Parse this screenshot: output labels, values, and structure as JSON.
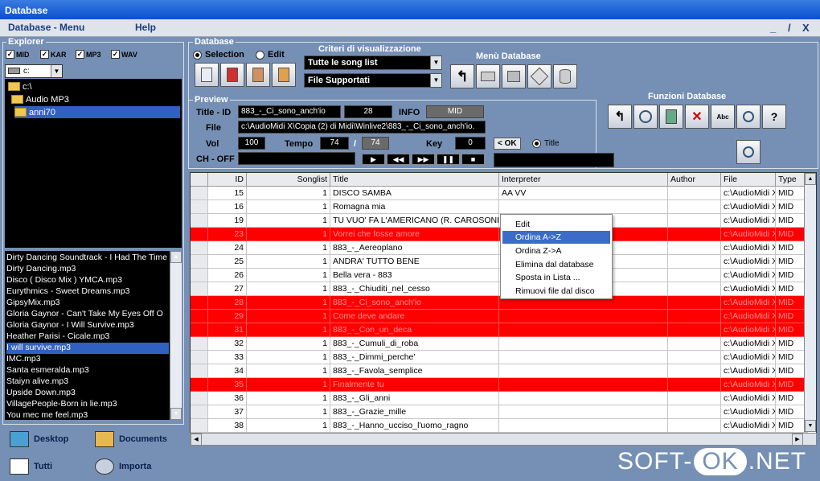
{
  "window": {
    "title": "Database"
  },
  "menu": {
    "items": [
      "Database - Menu",
      "Help"
    ],
    "controls": [
      "_",
      "/",
      "X"
    ]
  },
  "explorer": {
    "label": "Explorer",
    "filters": [
      {
        "label": "MID",
        "checked": true
      },
      {
        "label": "KAR",
        "checked": true
      },
      {
        "label": "MP3",
        "checked": true
      },
      {
        "label": "WAV",
        "checked": true
      }
    ],
    "drive": "c:",
    "tree": [
      "c:\\",
      "Audio MP3",
      "anni70"
    ],
    "files": [
      "Dirty Dancing Soundtrack - I Had The Time",
      "Dirty Dancing.mp3",
      "Disco ( Disco Mix ) YMCA.mp3",
      "Eurythmics - Sweet Dreams.mp3",
      "GipsyMix.mp3",
      "Gloria Gaynor - Can't Take My Eyes Off O",
      "Gloria Gaynor - I Will Survive.mp3",
      "Heather Parisi - Cicale.mp3",
      "I will survive.mp3",
      "IMC.mp3",
      "Santa esmeralda.mp3",
      "Staiyn alive.mp3",
      "Upside Down.mp3",
      "VillagePeople-Born in lie.mp3",
      "You mec me feel.mp3"
    ],
    "selected_file": 8,
    "nav": [
      "Desktop",
      "Documents",
      "Tutti",
      "Importa"
    ]
  },
  "database": {
    "label": "Database",
    "mode_selection": "Selection",
    "mode_edit": "Edit",
    "criteria_label": "Criteri di visualizzazione",
    "criteria_1": "Tutte le song list",
    "criteria_2": "File Supportati",
    "menu_label": "Menù Database",
    "functions_label": "Funzioni Database"
  },
  "preview": {
    "label": "Preview",
    "title_id_label": "Title - ID",
    "title_value": "883_-_Ci_sono_anch'io",
    "id_value": "28",
    "info_label": "INFO",
    "info_value": "MID",
    "file_label": "File",
    "file_value": "c:\\AudioMidi X\\Copia (2) di Midi\\Winlive2\\883_-_Ci_sono_anch'io.",
    "vol_label": "Vol",
    "vol_value": "100",
    "tempo_label": "Tempo",
    "tempo_value": "74",
    "tempo_sep": "/",
    "tempo_max": "74",
    "key_label": "Key",
    "key_value": "0",
    "ch_off_label": "CH - OFF",
    "ok_label": "< OK",
    "title_radio": "Title",
    "player": [
      "▶",
      "◀◀",
      "▶▶",
      "❚❚",
      "■"
    ]
  },
  "grid": {
    "columns": [
      "ID",
      "Songlist",
      "Title",
      "Interpreter",
      "Author",
      "File",
      "Type"
    ],
    "rows": [
      {
        "id": "15",
        "songlist": "1",
        "title": "DISCO SAMBA",
        "interpreter": "AA VV",
        "author": "",
        "file": "c:\\AudioMidi X",
        "type": "MID",
        "red": false
      },
      {
        "id": "16",
        "songlist": "1",
        "title": "Romagna mia",
        "interpreter": "",
        "author": "",
        "file": "c:\\AudioMidi X",
        "type": "MID",
        "red": false
      },
      {
        "id": "19",
        "songlist": "1",
        "title": "TU VUO' FA L'AMERICANO (R. CAROSONE)",
        "interpreter": "",
        "author": "",
        "file": "c:\\AudioMidi X",
        "type": "MID",
        "red": false
      },
      {
        "id": "23",
        "songlist": "1",
        "title": "Vorrei che fosse amore",
        "interpreter": "",
        "author": "",
        "file": "c:\\AudioMidi X",
        "type": "MID",
        "red": true
      },
      {
        "id": "24",
        "songlist": "1",
        "title": "883_-_Aereoplano",
        "interpreter": "",
        "author": "",
        "file": "c:\\AudioMidi X",
        "type": "MID",
        "red": false
      },
      {
        "id": "25",
        "songlist": "1",
        "title": "ANDRA' TUTTO BENE",
        "interpreter": "",
        "author": "",
        "file": "c:\\AudioMidi X",
        "type": "MID",
        "red": false
      },
      {
        "id": "26",
        "songlist": "1",
        "title": "Bella vera - 883",
        "interpreter": "",
        "author": "",
        "file": "c:\\AudioMidi X",
        "type": "MID",
        "red": false
      },
      {
        "id": "27",
        "songlist": "1",
        "title": "883_-_Chiuditi_nel_cesso",
        "interpreter": "",
        "author": "",
        "file": "c:\\AudioMidi X",
        "type": "MID",
        "red": false
      },
      {
        "id": "28",
        "songlist": "1",
        "title": "883_-_Ci_sono_anch'io",
        "interpreter": "",
        "author": "",
        "file": "c:\\AudioMidi X",
        "type": "MID",
        "red": true
      },
      {
        "id": "29",
        "songlist": "1",
        "title": "Come deve andare",
        "interpreter": "",
        "author": "",
        "file": "c:\\AudioMidi X",
        "type": "MID",
        "red": true
      },
      {
        "id": "31",
        "songlist": "1",
        "title": "883_-_Con_un_deca",
        "interpreter": "",
        "author": "",
        "file": "c:\\AudioMidi X",
        "type": "MID",
        "red": true
      },
      {
        "id": "32",
        "songlist": "1",
        "title": "883_-_Cumuli_di_roba",
        "interpreter": "",
        "author": "",
        "file": "c:\\AudioMidi X",
        "type": "MID",
        "red": false
      },
      {
        "id": "33",
        "songlist": "1",
        "title": "883_-_Dimmi_perche'",
        "interpreter": "",
        "author": "",
        "file": "c:\\AudioMidi X",
        "type": "MID",
        "red": false
      },
      {
        "id": "34",
        "songlist": "1",
        "title": "883_-_Favola_semplice",
        "interpreter": "",
        "author": "",
        "file": "c:\\AudioMidi X",
        "type": "MID",
        "red": false
      },
      {
        "id": "35",
        "songlist": "1",
        "title": "Finalmente tu",
        "interpreter": "",
        "author": "",
        "file": "c:\\AudioMidi X",
        "type": "MID",
        "red": true
      },
      {
        "id": "36",
        "songlist": "1",
        "title": "883_-_Gli_anni",
        "interpreter": "",
        "author": "",
        "file": "c:\\AudioMidi X",
        "type": "MID",
        "red": false
      },
      {
        "id": "37",
        "songlist": "1",
        "title": "883_-_Grazie_mille",
        "interpreter": "",
        "author": "",
        "file": "c:\\AudioMidi X",
        "type": "MID",
        "red": false
      },
      {
        "id": "38",
        "songlist": "1",
        "title": "883_-_Hanno_ucciso_l'uomo_ragno",
        "interpreter": "",
        "author": "",
        "file": "c:\\AudioMidi X",
        "type": "MID",
        "red": false
      }
    ]
  },
  "context_menu": {
    "items": [
      "Edit",
      "Ordina A->Z",
      "Ordina Z->A",
      "Elimina dal database",
      "Sposta in Lista ...",
      "Rimuovi file dal disco"
    ],
    "highlighted": 1
  },
  "watermark": {
    "left": "SOFT-",
    "ok": "OK",
    "right": ".NET"
  },
  "colors": {
    "panel": "#7690b5",
    "row_highlight": "#ff0000",
    "selection": "#3b6cc8"
  }
}
